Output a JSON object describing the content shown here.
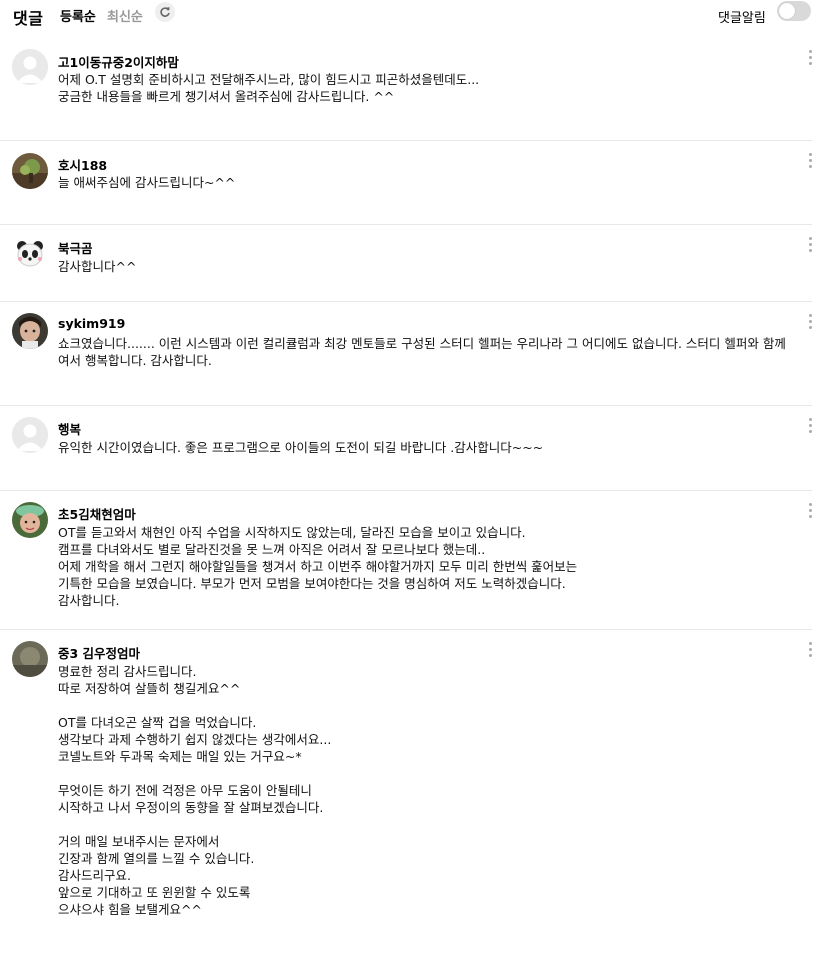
{
  "header": {
    "title": "댓글",
    "sort_active": "등록순",
    "sort_inactive": "최신순",
    "refresh_icon": "refresh-icon",
    "notif_label": "댓글알림",
    "notif_on": false
  },
  "comments": [
    {
      "author": "고1이동규중2이지하맘",
      "avatar": "default",
      "lines": [
        "어제 O.T 설명회 준비하시고 전달해주시느라, 많이 힘드시고 피곤하셨을텐데도...",
        "궁금한 내용들을 빠르게 챙기셔서 올려주심에 감사드립니다. ^^"
      ]
    },
    {
      "author": "호시188",
      "avatar": "photo-plant",
      "lines": [
        "늘 애써주심에 감사드립니다~^^"
      ]
    },
    {
      "author": "북극곰",
      "avatar": "panda",
      "lines": [
        "감사합니다^^"
      ]
    },
    {
      "author": "sykim919",
      "avatar": "photo-child",
      "lines": [
        "쇼크였습니다....... 이런 시스템과 이런 컬리큘럼과 최강 멘토들로 구성된 스터디 헬퍼는 우리나라 그 어디에도 없습니다. 스터디 헬퍼와 함께여서 행복합니다. 감사합니다."
      ]
    },
    {
      "author": "행복",
      "avatar": "default",
      "lines": [
        "유익한 시간이였습니다. 좋은 프로그램으로 아이들의 도전이 되길 바랍니다 .감사합니다~~~"
      ]
    },
    {
      "author": "초5김채현엄마",
      "avatar": "photo-hat",
      "lines": [
        "OT를 듣고와서 채현인 아직 수업을 시작하지도 않았는데, 달라진 모습을 보이고 있습니다.",
        "캠프를 다녀와서도 별로 달라진것을 못 느껴 아직은 어려서 잘 모르나보다 했는데..",
        "어제 개학을 해서 그런지 해야할일들을 챙겨서 하고 이번주 해야할거까지 모두 미리 한번씩 훑어보는",
        "기특한 모습을 보였습니다. 부모가 먼저 모범을 보여야한다는 것을 명심하여 저도 노력하겠습니다.",
        "감사합니다."
      ]
    },
    {
      "author": "중3 김우정엄마",
      "avatar": "photo-dark",
      "lines": [
        "명료한 정리 감사드립니다.",
        "따로 저장하여 살뜰히 챙길게요^^",
        "",
        "OT를 다녀오곤 살짝 겁을 먹었습니다.",
        "생각보다 과제 수행하기 쉽지 않겠다는 생각에서요...",
        "코넬노트와 두과목 숙제는 매일 있는 거구요~*",
        "",
        "무엇이든 하기 전에 걱정은 아무 도움이 안될테니",
        "시작하고 나서 우정이의 동향을 잘 살펴보겠습니다.",
        "",
        "거의 매일 보내주시는 문자에서",
        "긴장과 함께 열의를 느낄 수 있습니다.",
        "감사드리구요.",
        "앞으로 기대하고 또 윈윈할 수 있도록",
        "으샤으샤 힘을 보탤게요^^"
      ]
    }
  ]
}
